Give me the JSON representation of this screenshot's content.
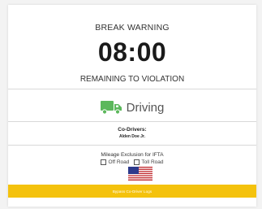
{
  "warning": {
    "title": "BREAK WARNING",
    "timer": "08:00",
    "subtitle": "REMAINING TO VIOLATION"
  },
  "status": {
    "icon": "truck-icon",
    "label": "Driving",
    "color": "#5cb85c"
  },
  "co_drivers": {
    "label": "Co-Drivers:",
    "name": "Alden Doe Jr."
  },
  "mileage": {
    "title": "Mileage Exclusion for IFTA",
    "off_road_label": "Off Road",
    "off_road_checked": false,
    "toll_road_label": "Toll Road",
    "toll_road_checked": false,
    "flag_icon": "us-flag-icon"
  },
  "action": {
    "label": "Bypass Co-Driver Logs",
    "color": "#f4c20d"
  }
}
